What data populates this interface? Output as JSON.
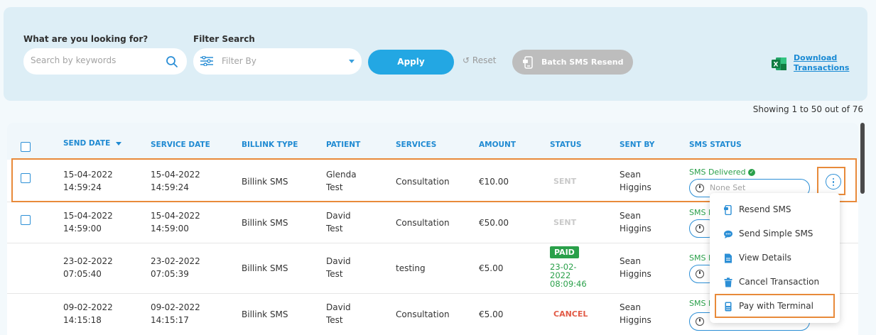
{
  "filters": {
    "search_label": "What are you looking for?",
    "search_placeholder": "Search by keywords",
    "filter_label": "Filter Search",
    "filter_placeholder": "Filter By",
    "apply_label": "Apply",
    "reset_label": "Reset",
    "batch_label": "Batch SMS Resend",
    "download_line1": "Download",
    "download_line2": "Transactions"
  },
  "showing_text": "Showing 1 to 50 out of 76",
  "table": {
    "columns": [
      "SEND DATE",
      "SERVICE DATE",
      "BILLINK TYPE",
      "PATIENT",
      "SERVICES",
      "AMOUNT",
      "STATUS",
      "SENT BY",
      "SMS STATUS"
    ],
    "rows": [
      {
        "send_date": "15-04-2022",
        "send_time": "14:59:24",
        "service_date": "15-04-2022",
        "service_time": "14:59:24",
        "type": "Billink SMS",
        "patient_first": "Glenda",
        "patient_last": "Test",
        "service": "Consultation",
        "amount": "€10.00",
        "status": "SENT",
        "sent_first": "Sean",
        "sent_last": "Higgins",
        "sms_status": "SMS Delivered",
        "schedule": "None Set"
      },
      {
        "send_date": "15-04-2022",
        "send_time": "14:59:00",
        "service_date": "15-04-2022",
        "service_time": "14:59:00",
        "type": "Billink SMS",
        "patient_first": "David",
        "patient_last": "Test",
        "service": "Consultation",
        "amount": "€50.00",
        "status": "SENT",
        "sent_first": "Sean",
        "sent_last": "Higgins",
        "sms_status": "SMS D"
      },
      {
        "send_date": "23-02-2022",
        "send_time": "07:05:40",
        "service_date": "23-02-2022",
        "service_time": "07:05:39",
        "type": "Billink SMS",
        "patient_first": "David",
        "patient_last": "Test",
        "service": "testing",
        "amount": "€5.00",
        "status": "PAID",
        "paid_date_1": "23-02-",
        "paid_date_2": "2022",
        "paid_time": "08:09:46",
        "sent_first": "Sean",
        "sent_last": "Higgins",
        "sms_status": "SMS D"
      },
      {
        "send_date": "09-02-2022",
        "send_time": "14:15:18",
        "service_date": "09-02-2022",
        "service_time": "14:15:17",
        "type": "Billink SMS",
        "patient_first": "David",
        "patient_last": "Test",
        "service": "Consultation",
        "amount": "€5.00",
        "status": "CANCEL",
        "sent_first": "Sean",
        "sent_last": "Higgins",
        "sms_status": "SMS D"
      }
    ]
  },
  "menu": {
    "items": [
      "Resend SMS",
      "Send Simple SMS",
      "View Details",
      "Cancel Transaction",
      "Pay with Terminal"
    ],
    "icons": [
      "resend-sms-icon",
      "chat-bubble-icon",
      "document-icon",
      "trash-icon",
      "card-terminal-icon"
    ]
  },
  "colors": {
    "accent": "#23a7e3",
    "header_text": "#1f8ad2",
    "paid": "#2aa04a",
    "cancel": "#e25b47",
    "highlight": "#e88a3a"
  }
}
